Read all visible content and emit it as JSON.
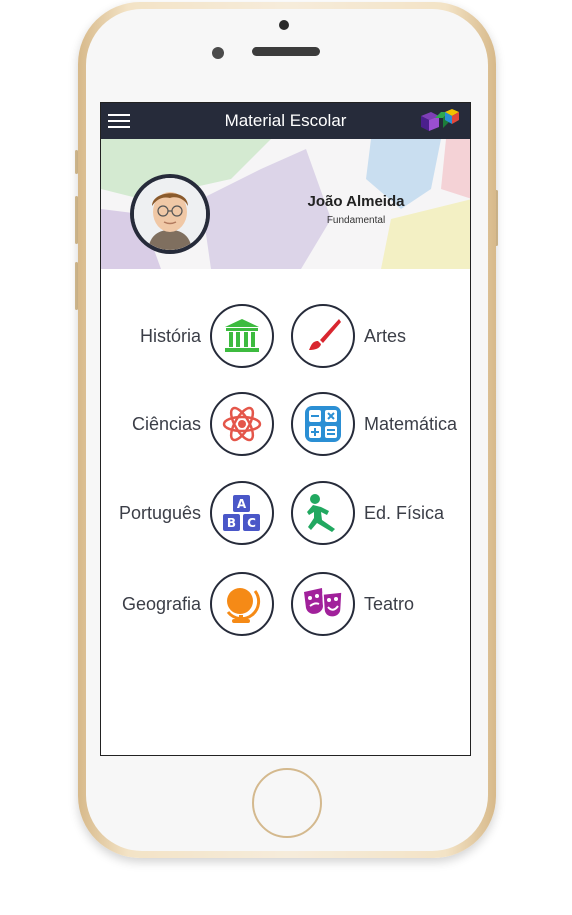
{
  "header": {
    "title": "Material Escolar"
  },
  "profile": {
    "name": "João Almeida",
    "level": "Fundamental"
  },
  "subjects": {
    "historia": {
      "label": "História",
      "color": "#3dbb3f"
    },
    "artes": {
      "label": "Artes",
      "color": "#d9262f"
    },
    "ciencias": {
      "label": "Ciências",
      "color": "#e4564a"
    },
    "matematica": {
      "label": "Matemática",
      "color": "#2b8fd4"
    },
    "portugues": {
      "label": "Português",
      "color": "#4a57c8"
    },
    "edfisica": {
      "label": "Ed. Física",
      "color": "#21a860"
    },
    "geografia": {
      "label": "Geografia",
      "color": "#f58a16"
    },
    "teatro": {
      "label": "Teatro",
      "color": "#a1219b"
    }
  }
}
